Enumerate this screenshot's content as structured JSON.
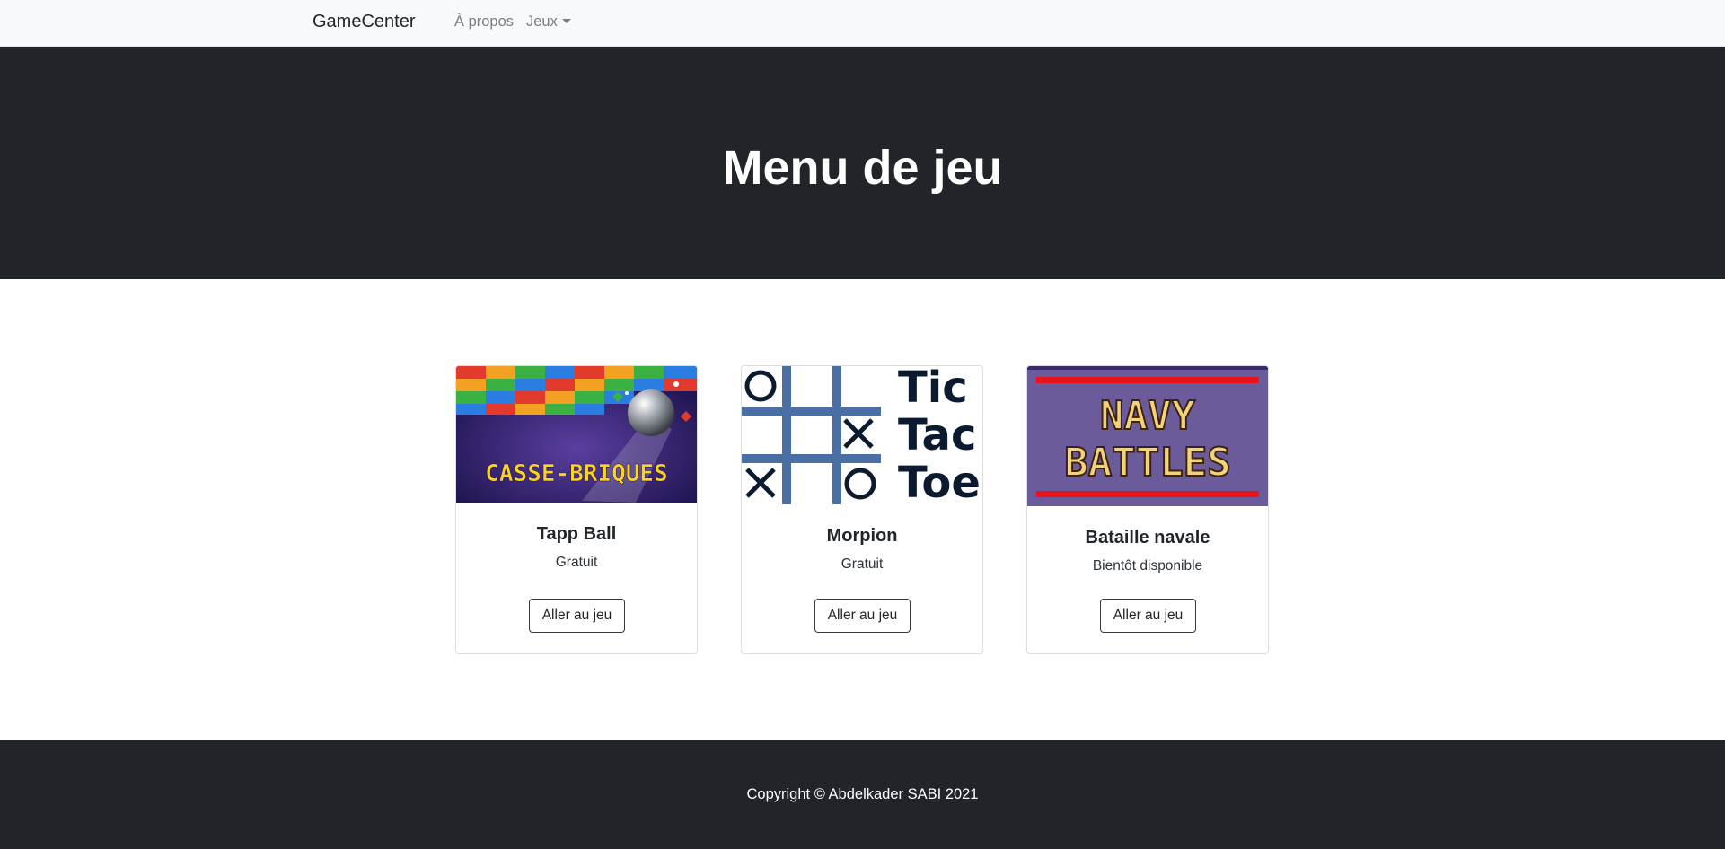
{
  "navbar": {
    "brand": "GameCenter",
    "links": [
      {
        "label": "À propos"
      },
      {
        "label": "Jeux"
      }
    ]
  },
  "hero": {
    "title": "Menu de jeu"
  },
  "cards": [
    {
      "title": "Tapp Ball",
      "subtitle": "Gratuit",
      "button": "Aller au jeu",
      "image_text": "CASSE-BRIQUES"
    },
    {
      "title": "Morpion",
      "subtitle": "Gratuit",
      "button": "Aller au jeu",
      "image_text": [
        "Tic",
        "Tac",
        "Toe"
      ]
    },
    {
      "title": "Bataille navale",
      "subtitle": "Bientôt disponible",
      "button": "Aller au jeu",
      "image_text": [
        "NAVY",
        "BATTLES"
      ]
    }
  ],
  "footer": {
    "copyright": "Copyright © Abdelkader SABI 2021"
  },
  "colors": {
    "dark": "#212529",
    "navbar_bg": "#f8f9fa",
    "morpion_grid": "#4a6fa5",
    "navy_bg": "#6b5b9a"
  }
}
